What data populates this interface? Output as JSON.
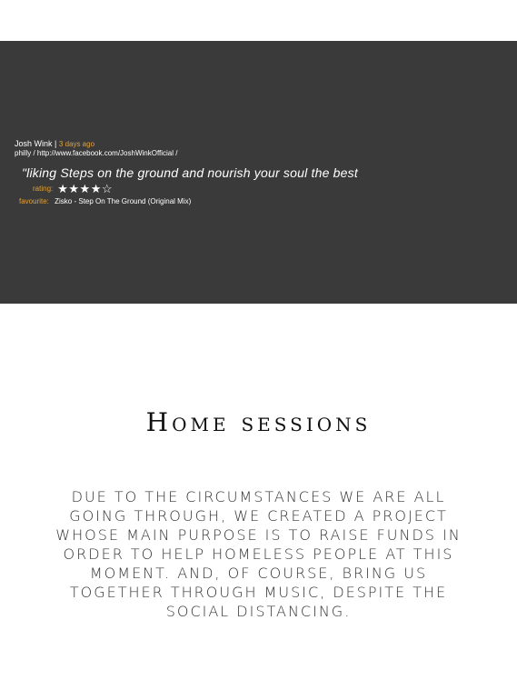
{
  "review": {
    "author": "Josh Wink",
    "separator": "|",
    "time_ago": "3 days ago",
    "source": "philly / http://www.facebook.com/JoshWinkOfficial /",
    "quote": "\"liking Steps on the ground and nourish your soul the best",
    "rating_label": "rating:",
    "rating_stars_display": "★★★★☆",
    "rating_value": 4,
    "rating_max": 5,
    "favourite_label": "favourite:",
    "favourite_track": "Zisko - Step On The Ground (Original Mix)"
  },
  "home_sessions": {
    "title": "Home sessions",
    "body": "Due to the circumstances we are all going through, we created a project whose main purpose is to raise funds in order to help homeless people at this moment. And, of course, bring us together through music, despite the social distancing."
  },
  "colors": {
    "banner_background": "#3a3a3a",
    "accent_orange": "#e0a23c",
    "text_light": "#ffffff",
    "text_dark": "#111111"
  }
}
